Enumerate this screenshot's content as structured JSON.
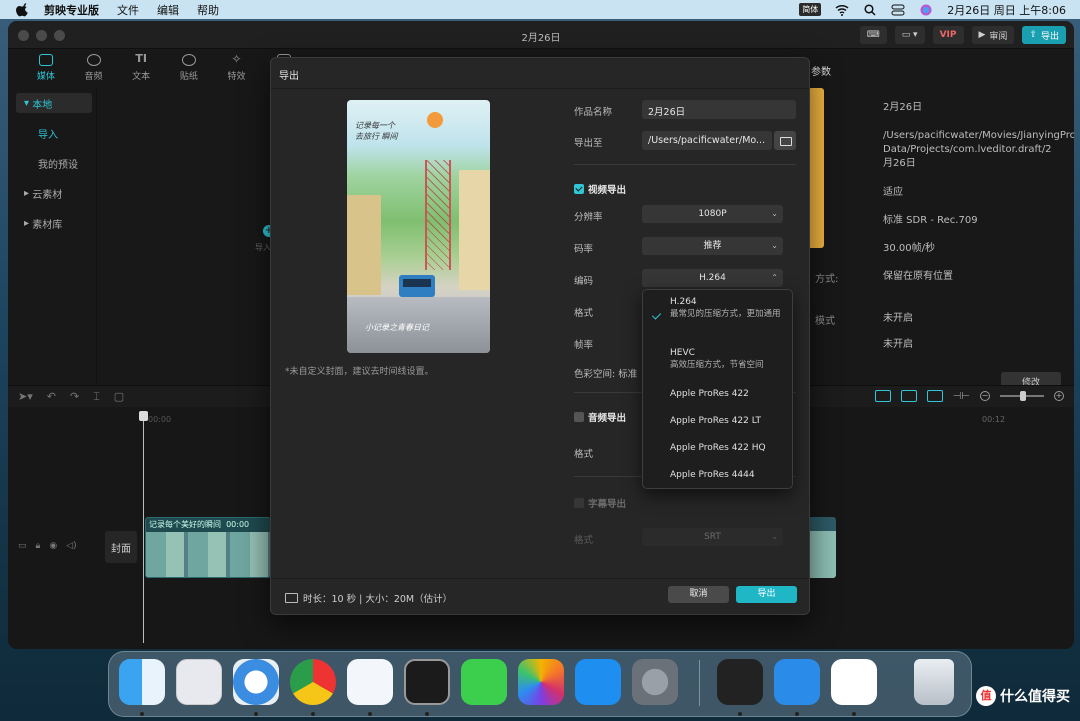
{
  "menubar": {
    "app_name": "剪映专业版",
    "items": [
      "文件",
      "编辑",
      "帮助"
    ],
    "ime": "简体",
    "datetime": "2月26日 周日 上午8:06"
  },
  "window": {
    "title": "2月26日",
    "vip_label": "VIP",
    "review_label": "审阅",
    "export_label": "导出"
  },
  "toolbar": {
    "tools": [
      {
        "label": "媒体"
      },
      {
        "label": "音频"
      },
      {
        "label": "文本"
      },
      {
        "label": "贴纸"
      },
      {
        "label": "特效"
      },
      {
        "label": "转"
      }
    ]
  },
  "sidebar": {
    "local": "本地",
    "import": "导入",
    "presets": "我的预设",
    "cloud": "云素材",
    "library": "素材库"
  },
  "media": {
    "import_label": "导入"
  },
  "params_panel": {
    "title": "参数",
    "rows": [
      {
        "key": "",
        "value": "2月26日"
      },
      {
        "key": "",
        "value": "/Users/pacificwater/Movies/JianyingPro/User Data/Projects/com.lveditor.draft/2月26日"
      },
      {
        "key": "",
        "value": "适应"
      },
      {
        "key": "",
        "value": "标准 SDR - Rec.709"
      },
      {
        "key": "",
        "value": "30.00帧/秒"
      },
      {
        "key": "方式:",
        "value": "保留在原有位置"
      },
      {
        "key": "模式",
        "value": "未开启"
      },
      {
        "key": "",
        "value": "未开启"
      }
    ],
    "modify_label": "修改"
  },
  "timeline": {
    "ruler_start": "00:00",
    "ruler_mark": "00:12",
    "cover_label": "封面",
    "clip_title": "记录每个美好的瞬间",
    "clip_time": "00:00"
  },
  "dialog": {
    "title": "导出",
    "cover_hint": "*未自定义封面，建议去时间线设置。",
    "work_name_label": "作品名称",
    "work_name_value": "2月26日",
    "export_to_label": "导出至",
    "export_to_value": "/Users/pacificwater/Mo...",
    "video_export_label": "视频导出",
    "resolution_label": "分辨率",
    "resolution_value": "1080P",
    "bitrate_label": "码率",
    "bitrate_value": "推荐",
    "codec_label": "编码",
    "codec_value": "H.264",
    "format_label": "格式",
    "framerate_label": "帧率",
    "colorspace_label": "色彩空间:",
    "colorspace_value": "标准",
    "audio_export_label": "音频导出",
    "audio_format_label": "格式",
    "subtitle_export_label": "字幕导出",
    "subtitle_format_label": "格式",
    "subtitle_format_value": "SRT",
    "footer_info": "时长：10 秒 | 大小：20M（估计）",
    "cancel_label": "取消",
    "export_label": "导出"
  },
  "codec_menu": {
    "options": [
      {
        "name": "H.264",
        "desc": "最常见的压缩方式，更加通用",
        "selected": true
      },
      {
        "name": "HEVC",
        "desc": "高效压缩方式，节省空间",
        "selected": false
      },
      {
        "name": "Apple ProRes 422",
        "desc": "",
        "selected": false
      },
      {
        "name": "Apple ProRes 422 LT",
        "desc": "",
        "selected": false
      },
      {
        "name": "Apple ProRes 422 HQ",
        "desc": "",
        "selected": false
      },
      {
        "name": "Apple ProRes 4444",
        "desc": "",
        "selected": false
      }
    ]
  },
  "preview": {
    "top_text": "记录每一个",
    "top_text2": "去旅行 瞬间",
    "bottom_text": "小记录之青春日记"
  },
  "dock": {
    "apps": [
      "finder-icon",
      "launchpad-icon",
      "safari-icon",
      "chrome-icon",
      "rocket-icon",
      "activity-monitor-icon",
      "messages-icon",
      "photos-icon",
      "app-store-icon",
      "system-preferences-icon",
      "stocks-icon",
      "preview-icon",
      "capcut-icon",
      "trash-icon"
    ]
  },
  "watermark": {
    "text": "什么值得买",
    "badge": "值"
  },
  "colors": {
    "accent": "#2fc6d6",
    "export_button": "#1fb6c6"
  }
}
